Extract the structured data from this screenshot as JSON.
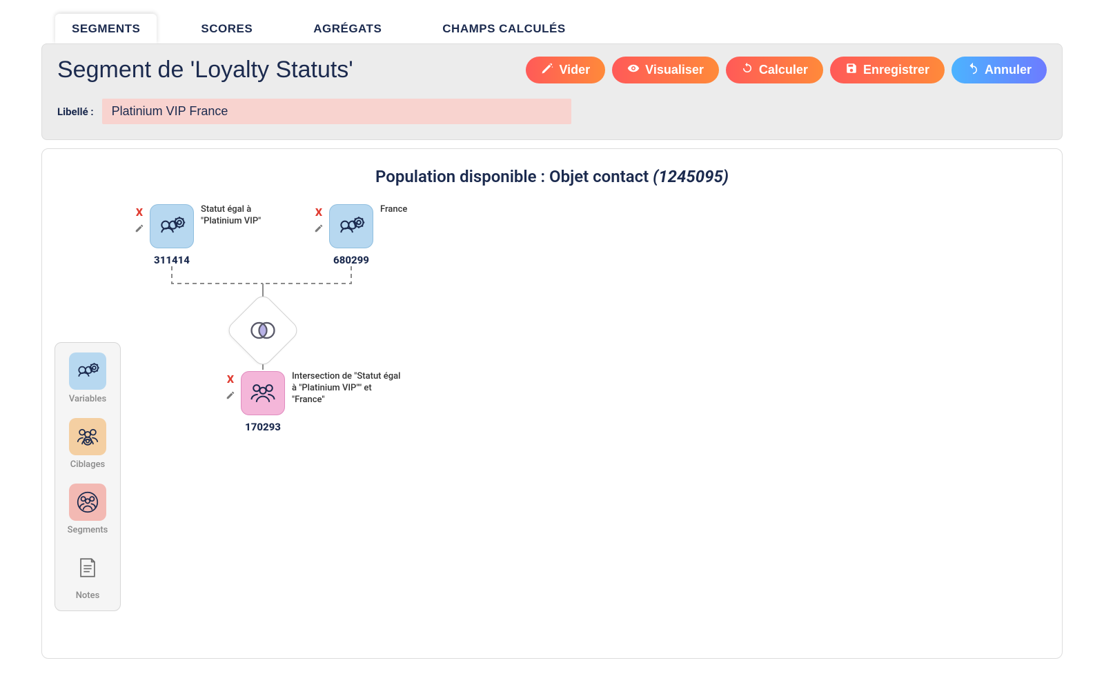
{
  "tabs": {
    "segments": "SEGMENTS",
    "scores": "SCORES",
    "aggregats": "AGRÉGATS",
    "champs": "CHAMPS CALCULÉS"
  },
  "header": {
    "title": "Segment de 'Loyalty Statuts'",
    "libelle_label": "Libellé :",
    "libelle_value": "Platinium VIP France"
  },
  "actions": {
    "vider": "Vider",
    "visualiser": "Visualiser",
    "calculer": "Calculer",
    "enregistrer": "Enregistrer",
    "annuler": "Annuler"
  },
  "population": {
    "prefix": "Population disponible : Objet contact ",
    "count": "(1245095)"
  },
  "palette": {
    "variables": "Variables",
    "ciblages": "Ciblages",
    "segments": "Segments",
    "notes": "Notes"
  },
  "nodes": {
    "statut": {
      "count": "311414",
      "desc": "Statut égal à \"Platinium VIP\""
    },
    "france": {
      "count": "680299",
      "desc": "France"
    },
    "intersection": {
      "count": "170293",
      "desc": "Intersection de \"Statut égal à \"Platinium VIP\"\" et \"France\""
    }
  },
  "controls": {
    "x": "X"
  }
}
